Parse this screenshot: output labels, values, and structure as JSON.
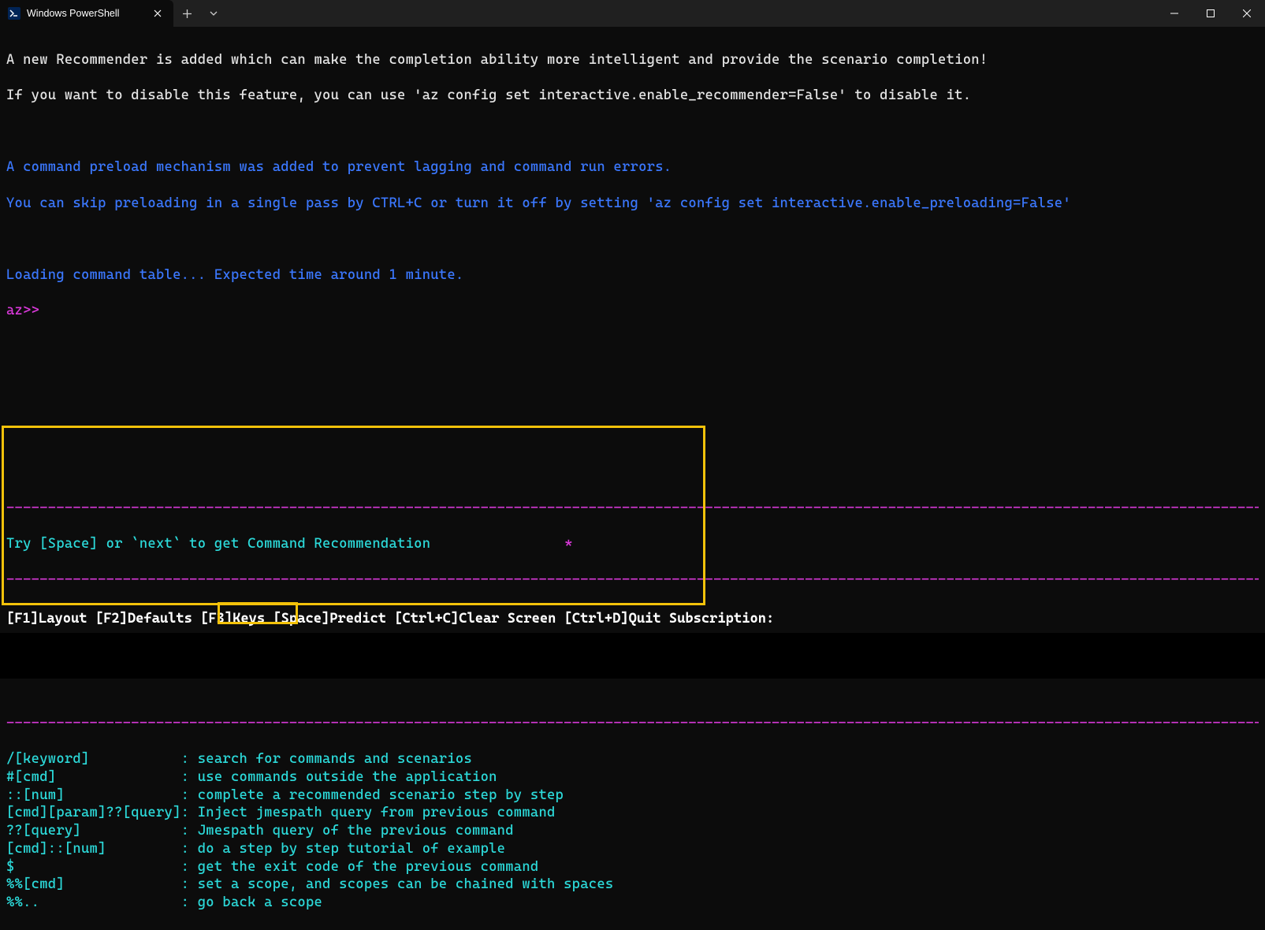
{
  "titlebar": {
    "tab_title": "Windows PowerShell"
  },
  "lines": {
    "rec1": "A new Recommender is added which can make the completion ability more intelligent and provide the scenario completion!",
    "rec2": "If you want to disable this feature, you can use 'az config set interactive.enable_recommender=False' to disable it.",
    "pre1": "A command preload mechanism was added to prevent lagging and command run errors.",
    "pre2": "You can skip preloading in a single pass by CTRL+C or turn it off by setting 'az config set interactive.enable_preloading=False'",
    "loading": "Loading command table... Expected time around 1 minute.",
    "prompt": "az>>"
  },
  "hint": {
    "text": "Try [Space] or `next` to get Command Recommendation",
    "star": "*"
  },
  "cheats": [
    {
      "key": "/[keyword]",
      "desc": "search for commands and scenarios"
    },
    {
      "key": "#[cmd]",
      "desc": "use commands outside the application"
    },
    {
      "key": "::[num]",
      "desc": "complete a recommended scenario step by step"
    },
    {
      "key": "[cmd][param]??[query]",
      "desc": "Inject jmespath query from previous command"
    },
    {
      "key": "??[query]",
      "desc": "Jmespath query of the previous command"
    },
    {
      "key": "[cmd]::[num]",
      "desc": "do a step by step tutorial of example"
    },
    {
      "key": "$",
      "desc": "get the exit code of the previous command"
    },
    {
      "key": "%%[cmd]",
      "desc": "set a scope, and scopes can be chained with spaces"
    },
    {
      "key": "%%..",
      "desc": "go back a scope"
    }
  ],
  "footer": {
    "f1": "[F1]Layout",
    "f2": "[F2]Defaults",
    "f3": "[F3]Keys",
    "space": "[Space]Predict",
    "ctrlc": "[Ctrl+C]Clear Screen",
    "ctrld": "[Ctrl+D]Quit",
    "sub": "Subscription:"
  },
  "dashes": "-----------------------------------------------------------------------------------------------------------------------------------------------------------------------"
}
